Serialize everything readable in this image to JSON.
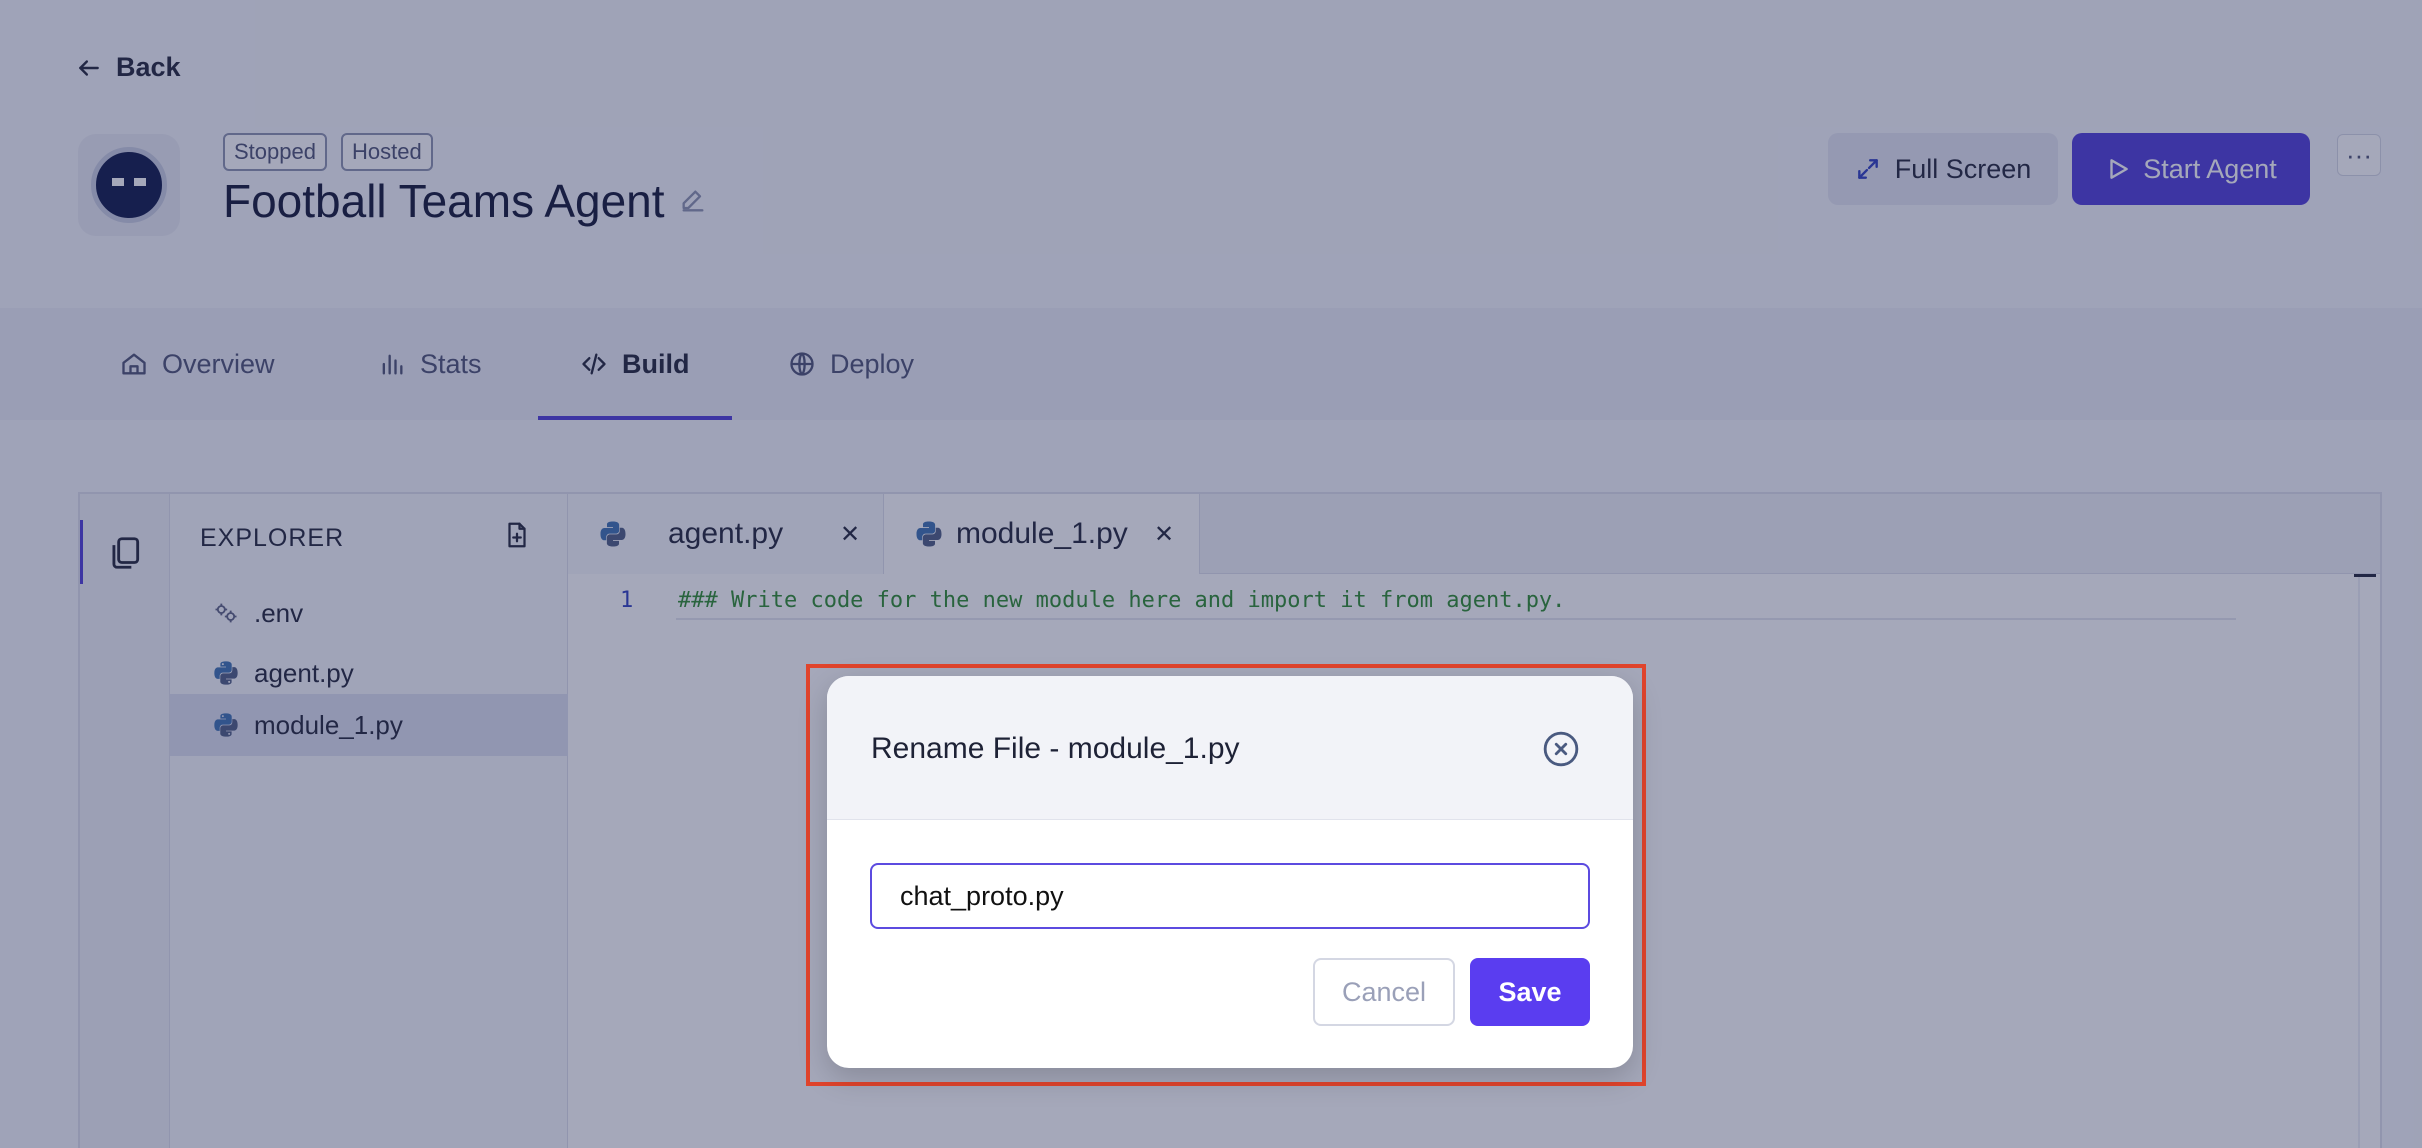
{
  "header": {
    "back_label": "Back",
    "badges": [
      "Stopped",
      "Hosted"
    ],
    "agent_name": "Football Teams Agent",
    "full_screen_label": "Full Screen",
    "start_agent_label": "Start Agent",
    "more_label": "···"
  },
  "tabs": [
    {
      "label": "Overview",
      "icon": "home-icon"
    },
    {
      "label": "Stats",
      "icon": "bar-chart-icon"
    },
    {
      "label": "Build",
      "icon": "code-icon",
      "active": true
    },
    {
      "label": "Deploy",
      "icon": "globe-icon"
    }
  ],
  "explorer": {
    "title": "EXPLORER",
    "files": [
      {
        "name": ".env",
        "icon": "settings-icon"
      },
      {
        "name": "agent.py",
        "icon": "python-icon"
      },
      {
        "name": "module_1.py",
        "icon": "python-icon",
        "active": true
      }
    ]
  },
  "editor": {
    "open_tabs": [
      {
        "name": "agent.py"
      },
      {
        "name": "module_1.py"
      }
    ],
    "line_number": "1",
    "code_line": "### Write code for the new module here and import it from agent.py."
  },
  "modal": {
    "title": "Rename File - module_1.py",
    "input_value": "chat_proto.py",
    "cancel_label": "Cancel",
    "save_label": "Save"
  },
  "colors": {
    "accent": "#4c3ad8",
    "save_button": "#5a3df0",
    "highlight_border": "#e0442c",
    "code_comment": "#2a8a2a"
  }
}
